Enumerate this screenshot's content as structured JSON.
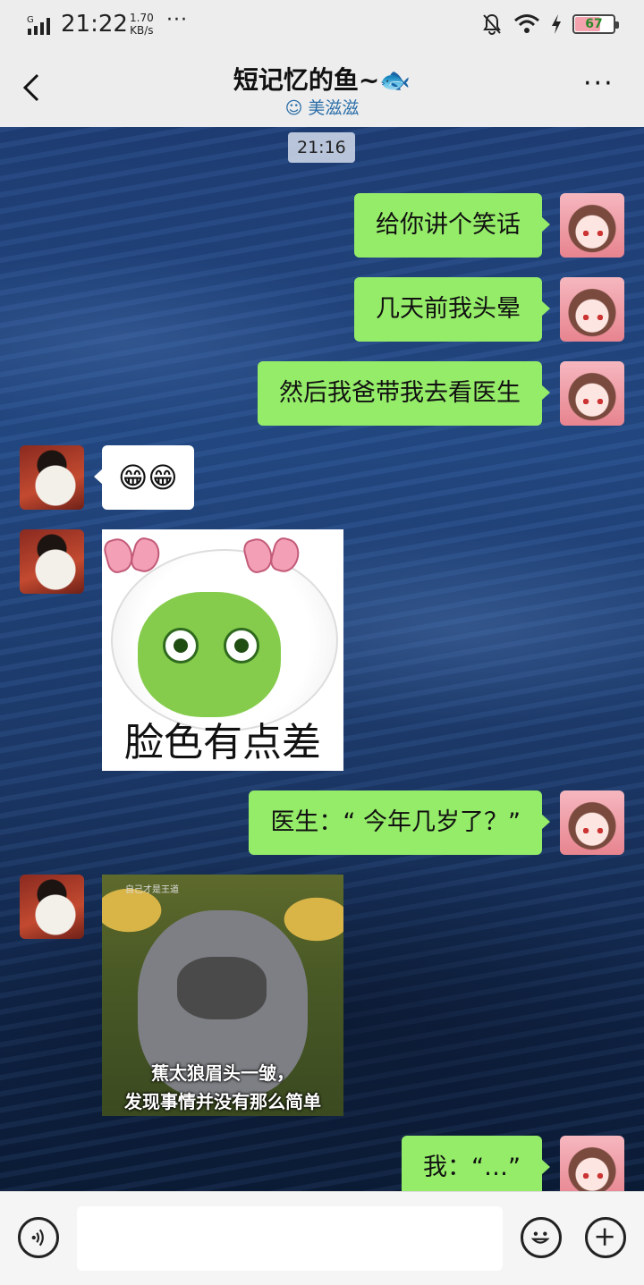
{
  "status_bar": {
    "network": "G",
    "time": "21:22",
    "speed_value": "1.70",
    "speed_unit": "KB/s",
    "more_dots": "···",
    "battery": "67",
    "battery_level": 0.67,
    "icons": [
      "signal-icon",
      "bell-off-icon",
      "wifi-icon",
      "charging-icon",
      "battery-icon"
    ]
  },
  "nav": {
    "title": "短记忆的鱼~🐟",
    "subtitle": "美滋滋",
    "subtitle_icon": "smile-emoji-icon",
    "back_icon": "chevron-left-icon",
    "more_label": "···"
  },
  "chat": {
    "timestamp": "21:16",
    "messages": [
      {
        "sender": "me",
        "type": "text",
        "text": "给你讲个笑话"
      },
      {
        "sender": "me",
        "type": "text",
        "text": "几天前我头晕"
      },
      {
        "sender": "me",
        "type": "text",
        "text": "然后我爸带我去看医生"
      },
      {
        "sender": "other",
        "type": "text",
        "text": "😁😁"
      },
      {
        "sender": "other",
        "type": "sticker",
        "caption": "脸色有点差"
      },
      {
        "sender": "me",
        "type": "text",
        "text": "医生：“ 今年几岁了？”"
      },
      {
        "sender": "other",
        "type": "sticker",
        "tag": "自己才是王道",
        "caption_lines": [
          "蕉太狼眉头一皱，",
          "发现事情并没有那么简单"
        ]
      },
      {
        "sender": "me",
        "type": "text",
        "text": "我：“…”"
      }
    ]
  },
  "input_bar": {
    "voice_icon": "voice-icon",
    "placeholder": "",
    "emoji_icon": "emoji-icon",
    "plus_icon": "plus-icon"
  },
  "colors": {
    "my_bubble": "#95ec69",
    "other_bubble": "#ffffff",
    "bar_background": "#ededed"
  }
}
